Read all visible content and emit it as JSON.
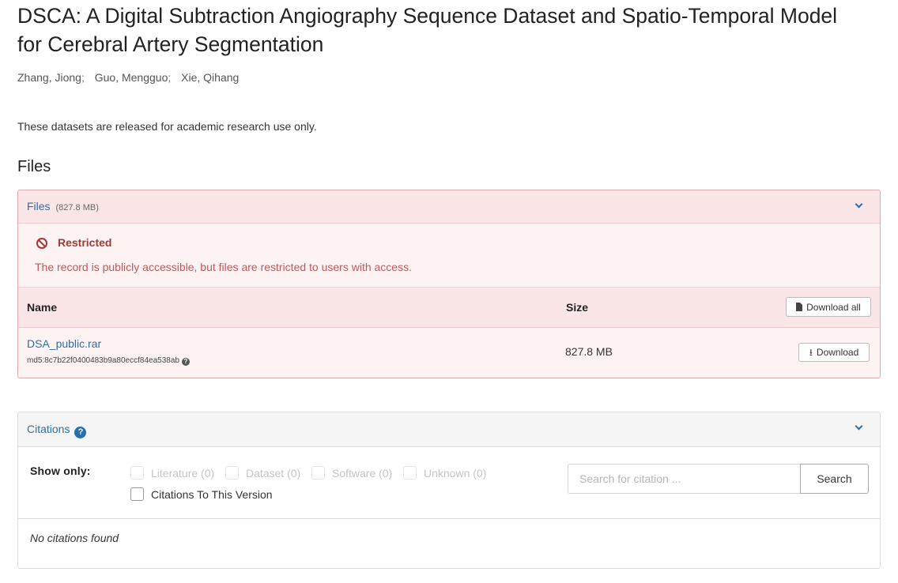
{
  "record": {
    "title": "DSCA: A Digital Subtraction Angiography Sequence Dataset and Spatio-Temporal Model for Cerebral Artery Segmentation",
    "authors": [
      "Zhang, Jiong",
      "Guo, Mengguo",
      "Xie, Qihang"
    ],
    "author_separator": ";",
    "note": "These datasets are released for academic research use only."
  },
  "files_section": {
    "heading": "Files",
    "panel": {
      "label": "Files",
      "total_size": "(827.8 MB)",
      "restricted_title": "Restricted",
      "restricted_text": "The record is publicly accessible, but files are restricted to users with access.",
      "col_name": "Name",
      "col_size": "Size",
      "download_all_label": "Download all",
      "files": [
        {
          "name": "DSA_public.rar",
          "md5": "md5:8c7b22f0400483b9a80eccf84ea538ab",
          "size": "827.8 MB",
          "download_label": "Download"
        }
      ]
    }
  },
  "citations": {
    "label": "Citations",
    "help_icon": "?",
    "show_only_label": "Show only:",
    "filters": [
      "Literature (0)",
      "Dataset (0)",
      "Software (0)",
      "Unknown (0)"
    ],
    "version_filter": "Citations To This Version",
    "search_placeholder": "Search for citation ...",
    "search_button": "Search",
    "empty_text": "No citations found"
  },
  "colors": {
    "link": "#2a6fa8",
    "restricted_text": "#9f3a38",
    "restricted_bg": "#fdf3f3",
    "restricted_header_bg": "#fbe6e7",
    "restricted_border": "#e0a9ae"
  }
}
